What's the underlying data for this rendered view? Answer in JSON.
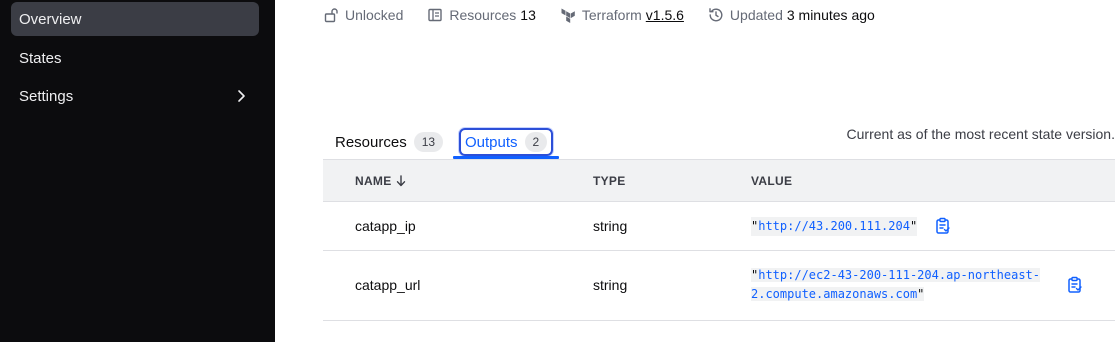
{
  "sidebar": {
    "items": [
      {
        "label": "Overview"
      },
      {
        "label": "States"
      },
      {
        "label": "Settings"
      }
    ]
  },
  "meta": {
    "lock_status": "Unlocked",
    "resources_label": "Resources",
    "resources_count": "13",
    "terraform_label": "Terraform",
    "terraform_version": "v1.5.6",
    "updated_label": "Updated",
    "updated_value": "3 minutes ago"
  },
  "tabs": [
    {
      "label": "Resources",
      "count": "13"
    },
    {
      "label": "Outputs",
      "count": "2"
    }
  ],
  "caption": "Current as of the most recent state version.",
  "table": {
    "headers": {
      "name": "NAME",
      "type": "TYPE",
      "value": "VALUE"
    },
    "rows": [
      {
        "name": "catapp_ip",
        "type": "string",
        "value_line1": "http://43.200.111.204",
        "value_line2": ""
      },
      {
        "name": "catapp_url",
        "type": "string",
        "value_line1": "http://ec2-43-200-111-204.ap-northeast-",
        "value_line2": "2.compute.amazonaws.com"
      }
    ]
  },
  "colors": {
    "sidebar_bg": "#0c0c0e",
    "sidebar_active": "#3b3d45",
    "accent": "#1060ff"
  }
}
